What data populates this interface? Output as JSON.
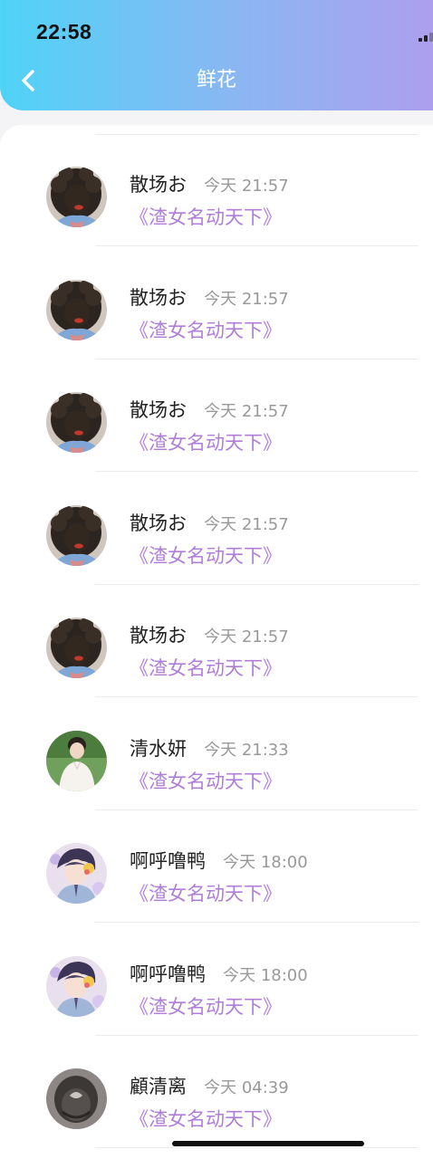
{
  "status_bar": {
    "time": "22:58"
  },
  "header": {
    "title": "鲜花"
  },
  "colors": {
    "gradient_start": "#4fd3f7",
    "gradient_end": "#ad9fee",
    "work_title": "#b07dd9",
    "timestamp": "#999999"
  },
  "list": [
    {
      "name": "散场お",
      "time": "今天 21:57",
      "work": "《渣女名动天下》",
      "avatar": "dark-curly-hair-avatar"
    },
    {
      "name": "散场お",
      "time": "今天 21:57",
      "work": "《渣女名动天下》",
      "avatar": "dark-curly-hair-avatar"
    },
    {
      "name": "散场お",
      "time": "今天 21:57",
      "work": "《渣女名动天下》",
      "avatar": "dark-curly-hair-avatar"
    },
    {
      "name": "散场お",
      "time": "今天 21:57",
      "work": "《渣女名动天下》",
      "avatar": "dark-curly-hair-avatar"
    },
    {
      "name": "散场お",
      "time": "今天 21:57",
      "work": "《渣女名动天下》",
      "avatar": "dark-curly-hair-avatar"
    },
    {
      "name": "清水妍",
      "time": "今天 21:33",
      "work": "《渣女名动天下》",
      "avatar": "man-white-shirt-avatar"
    },
    {
      "name": "啊呼噜鸭",
      "time": "今天 18:00",
      "work": "《渣女名动天下》",
      "avatar": "anime-boy-avatar"
    },
    {
      "name": "啊呼噜鸭",
      "time": "今天 18:00",
      "work": "《渣女名动天下》",
      "avatar": "anime-boy-avatar"
    },
    {
      "name": "顧清离",
      "time": "今天 04:39",
      "work": "《渣女名动天下》",
      "avatar": "hair-bow-avatar"
    }
  ]
}
